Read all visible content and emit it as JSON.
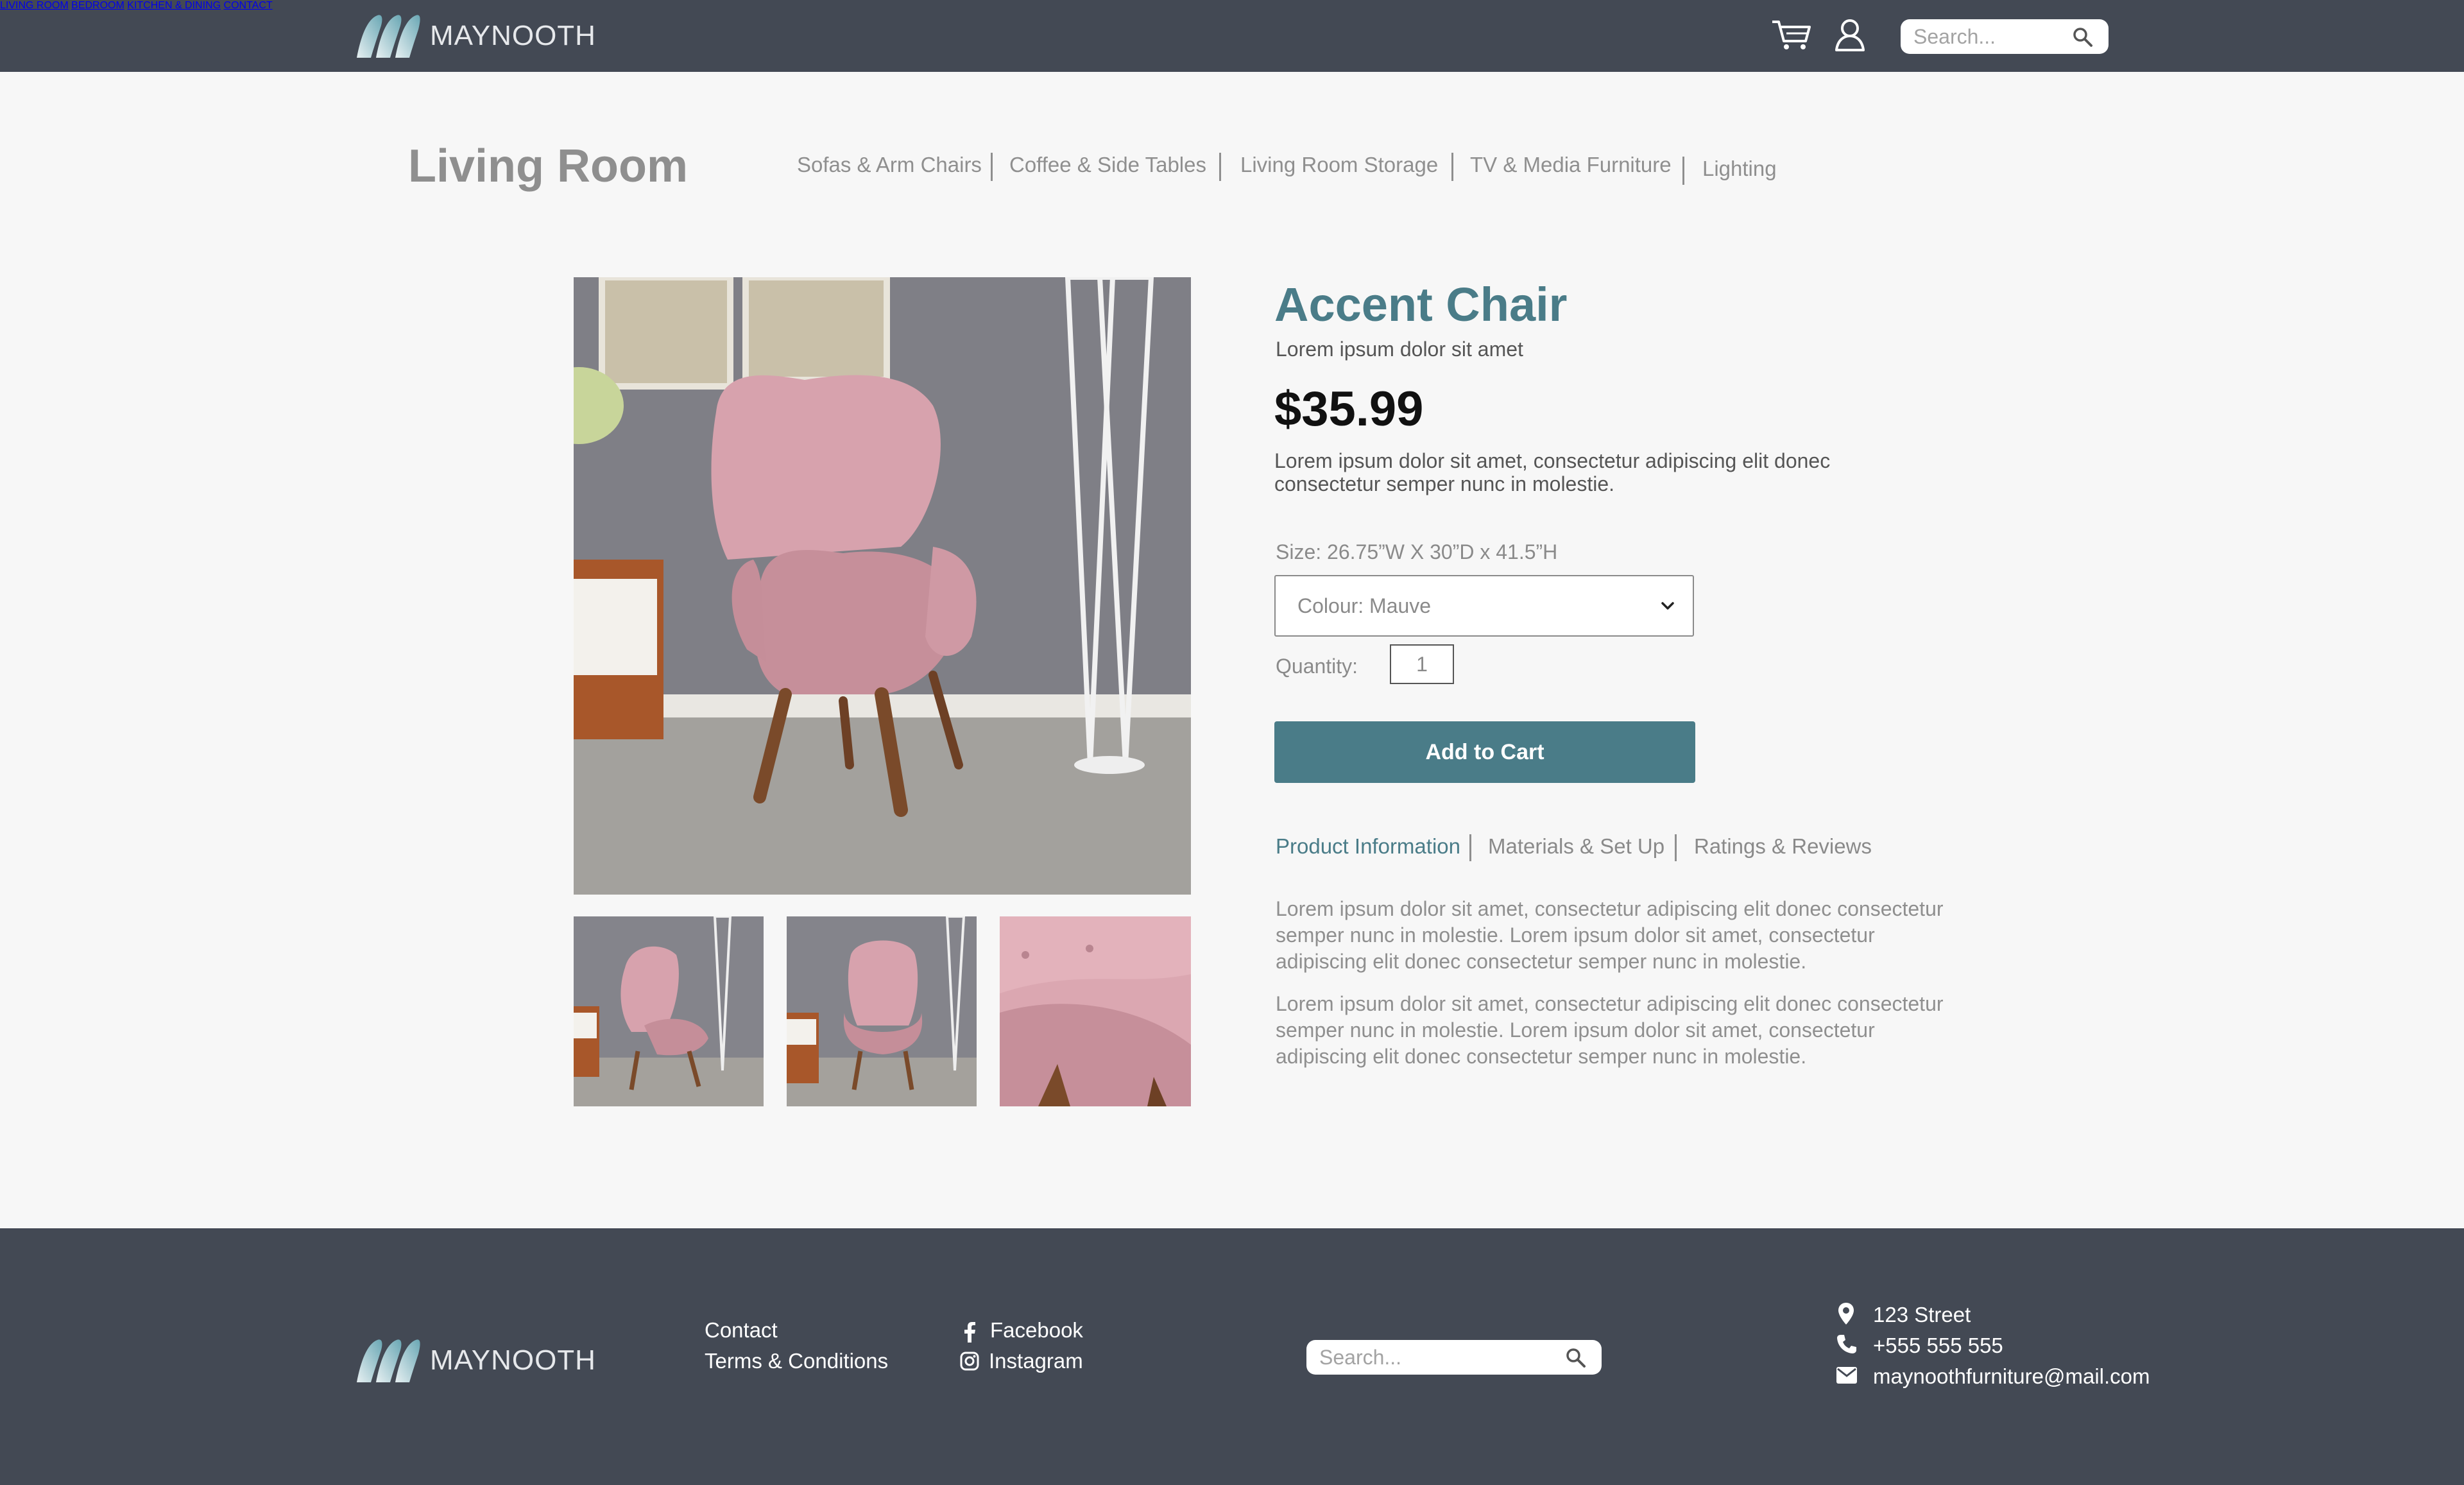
{
  "header": {
    "brand": "MAYNOOTH",
    "nav": [
      "LIVING ROOM",
      "BEDROOM",
      "KITCHEN & DINING",
      "CONTACT"
    ],
    "search_placeholder": "Search..."
  },
  "category": {
    "title": "Living Room",
    "links": [
      "Sofas & Arm Chairs",
      "Coffee & Side Tables",
      "Living Room Storage",
      "TV & Media Furniture",
      "Lighting"
    ]
  },
  "product": {
    "title": "Accent Chair",
    "subtitle": "Lorem ipsum dolor sit amet",
    "price": "$35.99",
    "description": "Lorem ipsum dolor sit amet, consectetur adipiscing elit donec consectetur semper nunc in molestie.",
    "size": "Size:  26.75”W X 30”D x 41.5”H",
    "colour_selected": "Colour: Mauve",
    "quantity_label": "Quantity:",
    "quantity_value": "1",
    "add_to_cart": "Add to Cart",
    "tabs": [
      "Product Information",
      "Materials & Set Up",
      "Ratings & Reviews"
    ],
    "active_tab": "Product Information",
    "paragraphs": [
      "Lorem ipsum dolor sit amet, consectetur adipiscing elit donec consectetur semper nunc in molestie. Lorem ipsum dolor sit amet, consectetur adipiscing elit donec consectetur semper nunc in molestie.",
      "Lorem ipsum dolor sit amet, consectetur adipiscing elit donec consectetur semper nunc in molestie. Lorem ipsum dolor sit amet, consectetur adipiscing elit donec consectetur semper nunc in molestie."
    ]
  },
  "footer": {
    "brand": "MAYNOOTH",
    "links": [
      "Contact",
      "Terms & Conditions"
    ],
    "social": [
      "Facebook",
      "Instagram"
    ],
    "search_placeholder": "Search...",
    "address": "123 Street",
    "phone": "+555 555 555",
    "email": "maynoothfurniture@mail.com"
  },
  "colors": {
    "header_bg": "#434954",
    "accent": "#4a7c88",
    "page_bg": "#f7f7f7",
    "chair": "#d7a2ad"
  },
  "icons": [
    "cart-icon",
    "user-icon",
    "search-icon",
    "chevron-down-icon",
    "facebook-icon",
    "instagram-icon",
    "location-pin-icon",
    "phone-icon",
    "mail-icon"
  ]
}
